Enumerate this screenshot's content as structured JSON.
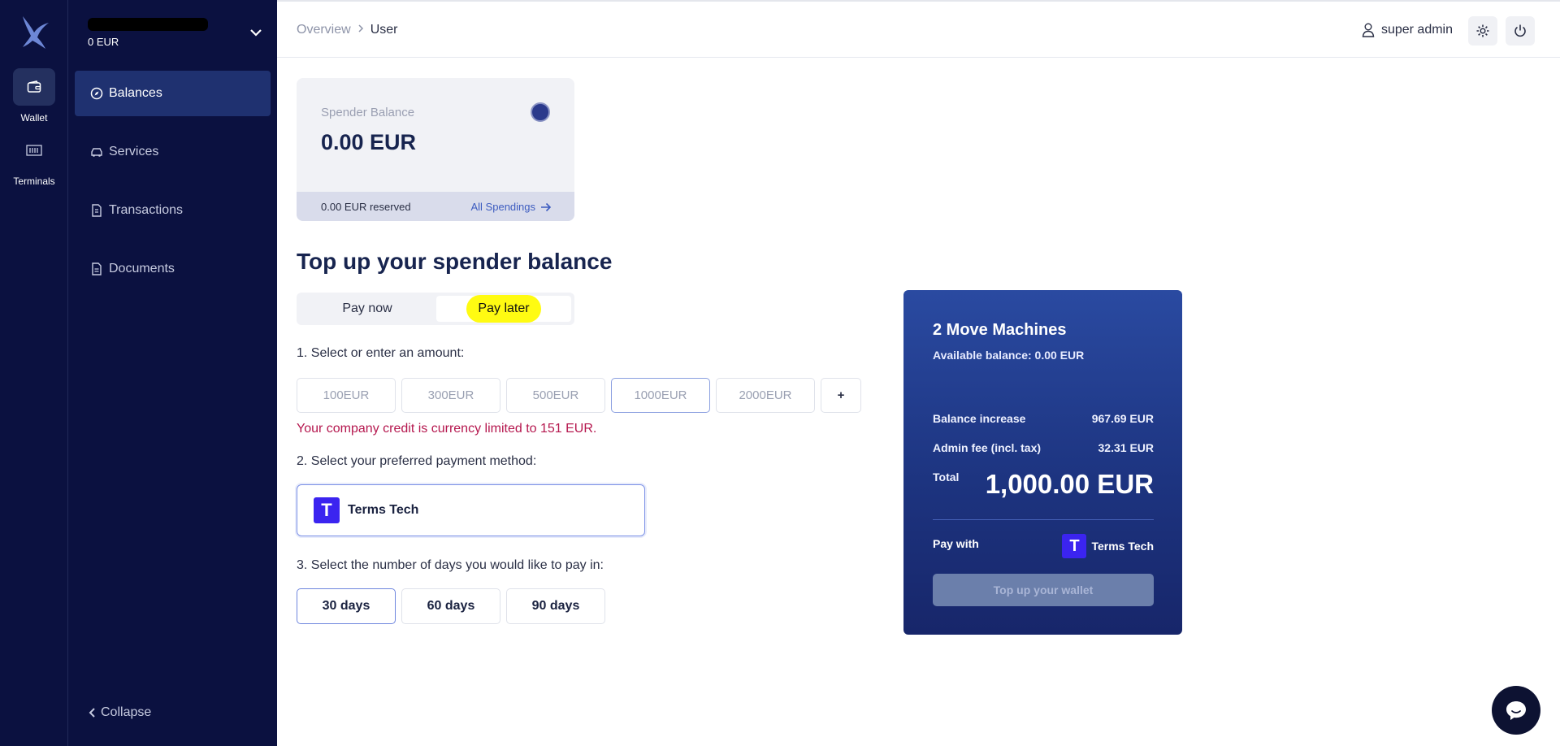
{
  "rail": {
    "items": [
      {
        "label": "Wallet",
        "icon": "wallet-icon"
      },
      {
        "label": "Terminals",
        "icon": "terminal-icon"
      }
    ]
  },
  "sidebar": {
    "org_balance": "0 EUR",
    "items": [
      {
        "label": "Balances",
        "icon": "compass-icon"
      },
      {
        "label": "Services",
        "icon": "car-icon"
      },
      {
        "label": "Transactions",
        "icon": "receipt-icon"
      },
      {
        "label": "Documents",
        "icon": "document-icon"
      }
    ],
    "collapse_label": "Collapse"
  },
  "header": {
    "breadcrumb": [
      "Overview",
      "User"
    ],
    "user_name": "super admin"
  },
  "balance_card": {
    "label": "Spender Balance",
    "amount": "0.00 EUR",
    "reserved": "0.00 EUR reserved",
    "link": "All Spendings"
  },
  "topup": {
    "title": "Top up your spender balance",
    "tabs": [
      "Pay now",
      "Pay later"
    ],
    "step1": "1. Select or enter an amount:",
    "amounts": [
      "100EUR",
      "300EUR",
      "500EUR",
      "1000EUR",
      "2000EUR"
    ],
    "selected_amount": "1000EUR",
    "plus_label": "+",
    "error": "Your company credit is currency limited to 151 EUR.",
    "step2": "2. Select your preferred payment method:",
    "method": "Terms Tech",
    "step3": "3. Select the number of days you would like to pay in:",
    "days": [
      "30 days",
      "60 days",
      "90 days"
    ],
    "selected_days": "30 days"
  },
  "summary": {
    "name": "2 Move Machines",
    "available": "Available balance: 0.00 EUR",
    "balance_increase_label": "Balance increase",
    "balance_increase_value": "967.69 EUR",
    "admin_fee_label": "Admin fee (incl. tax)",
    "admin_fee_value": "32.31 EUR",
    "total_label": "Total",
    "total_value": "1,000.00 EUR",
    "pay_with_label": "Pay with",
    "pay_with_value": "Terms Tech",
    "button": "Top up your wallet"
  },
  "colors": {
    "sidebar_bg": "#0b1140",
    "accent": "#1f3170",
    "highlight": "#fffb12",
    "error": "#b5174e",
    "brand_logo": "#3b24f0"
  }
}
